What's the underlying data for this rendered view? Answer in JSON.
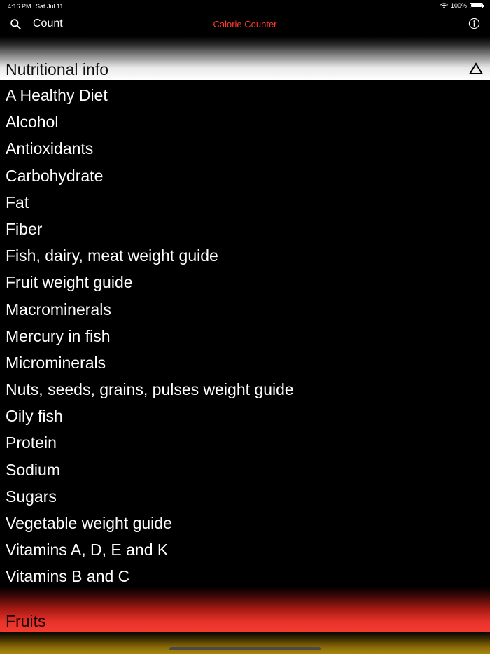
{
  "status_bar": {
    "time": "4:16 PM",
    "date": "Sat Jul 11",
    "battery": "100%"
  },
  "nav": {
    "count_label": "Count",
    "title": "Calorie Counter",
    "title_color": "#ff3b30"
  },
  "section": {
    "title": "Nutritional info",
    "items": [
      {
        "label": "A Healthy Diet"
      },
      {
        "label": "Alcohol"
      },
      {
        "label": "Antioxidants"
      },
      {
        "label": "Carbohydrate"
      },
      {
        "label": "Fat"
      },
      {
        "label": "Fiber"
      },
      {
        "label": "Fish, dairy, meat weight guide"
      },
      {
        "label": "Fruit weight guide"
      },
      {
        "label": "Macrominerals"
      },
      {
        "label": "Mercury in fish"
      },
      {
        "label": "Microminerals"
      },
      {
        "label": "Nuts, seeds, grains, pulses weight guide"
      },
      {
        "label": "Oily fish"
      },
      {
        "label": "Protein"
      },
      {
        "label": "Sodium"
      },
      {
        "label": "Sugars"
      },
      {
        "label": "Vegetable weight guide"
      },
      {
        "label": "Vitamins A, D, E and K"
      },
      {
        "label": "Vitamins B and C"
      }
    ]
  },
  "next_section": {
    "title": "Fruits",
    "color": "#f23a30"
  },
  "icons": {
    "search": "search-icon",
    "info": "info-icon",
    "collapse": "triangle-up-icon",
    "wifi": "wifi-icon",
    "battery": "battery-icon"
  }
}
